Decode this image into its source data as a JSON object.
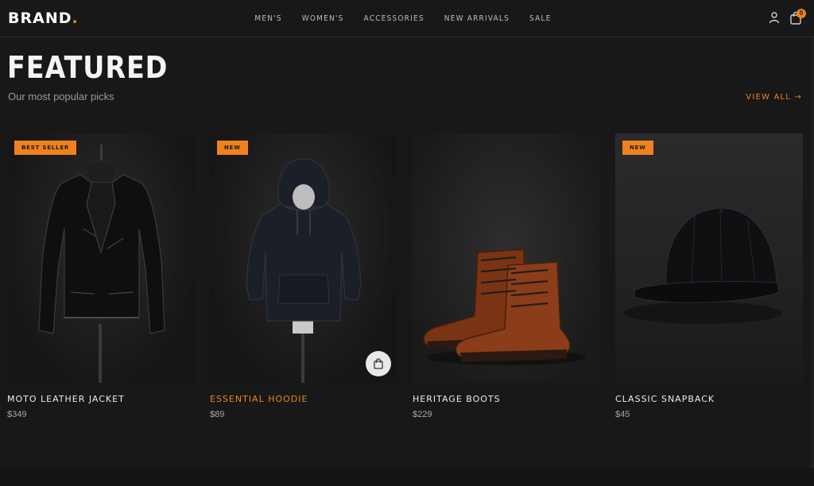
{
  "brand": {
    "name": "BRAND",
    "dot": "."
  },
  "nav": {
    "items": [
      "MEN'S",
      "WOMEN'S",
      "ACCESSORIES",
      "NEW ARRIVALS",
      "SALE"
    ],
    "cart_count": "0"
  },
  "featured": {
    "title": "FEATURED",
    "subtitle": "Our most popular picks",
    "view_all": "VIEW ALL →"
  },
  "products": [
    {
      "name": "MOTO LEATHER JACKET",
      "price": "$349",
      "badge": "BEST SELLER",
      "image_icon": "leather-jacket"
    },
    {
      "name": "ESSENTIAL HOODIE",
      "price": "$89",
      "badge": "NEW",
      "image_icon": "hoodie"
    },
    {
      "name": "HERITAGE BOOTS",
      "price": "$229",
      "badge": "",
      "image_icon": "boots"
    },
    {
      "name": "CLASSIC SNAPBACK",
      "price": "$45",
      "badge": "NEW",
      "image_icon": "cap"
    }
  ],
  "colors": {
    "accent": "#f0821e",
    "background": "#181818"
  }
}
